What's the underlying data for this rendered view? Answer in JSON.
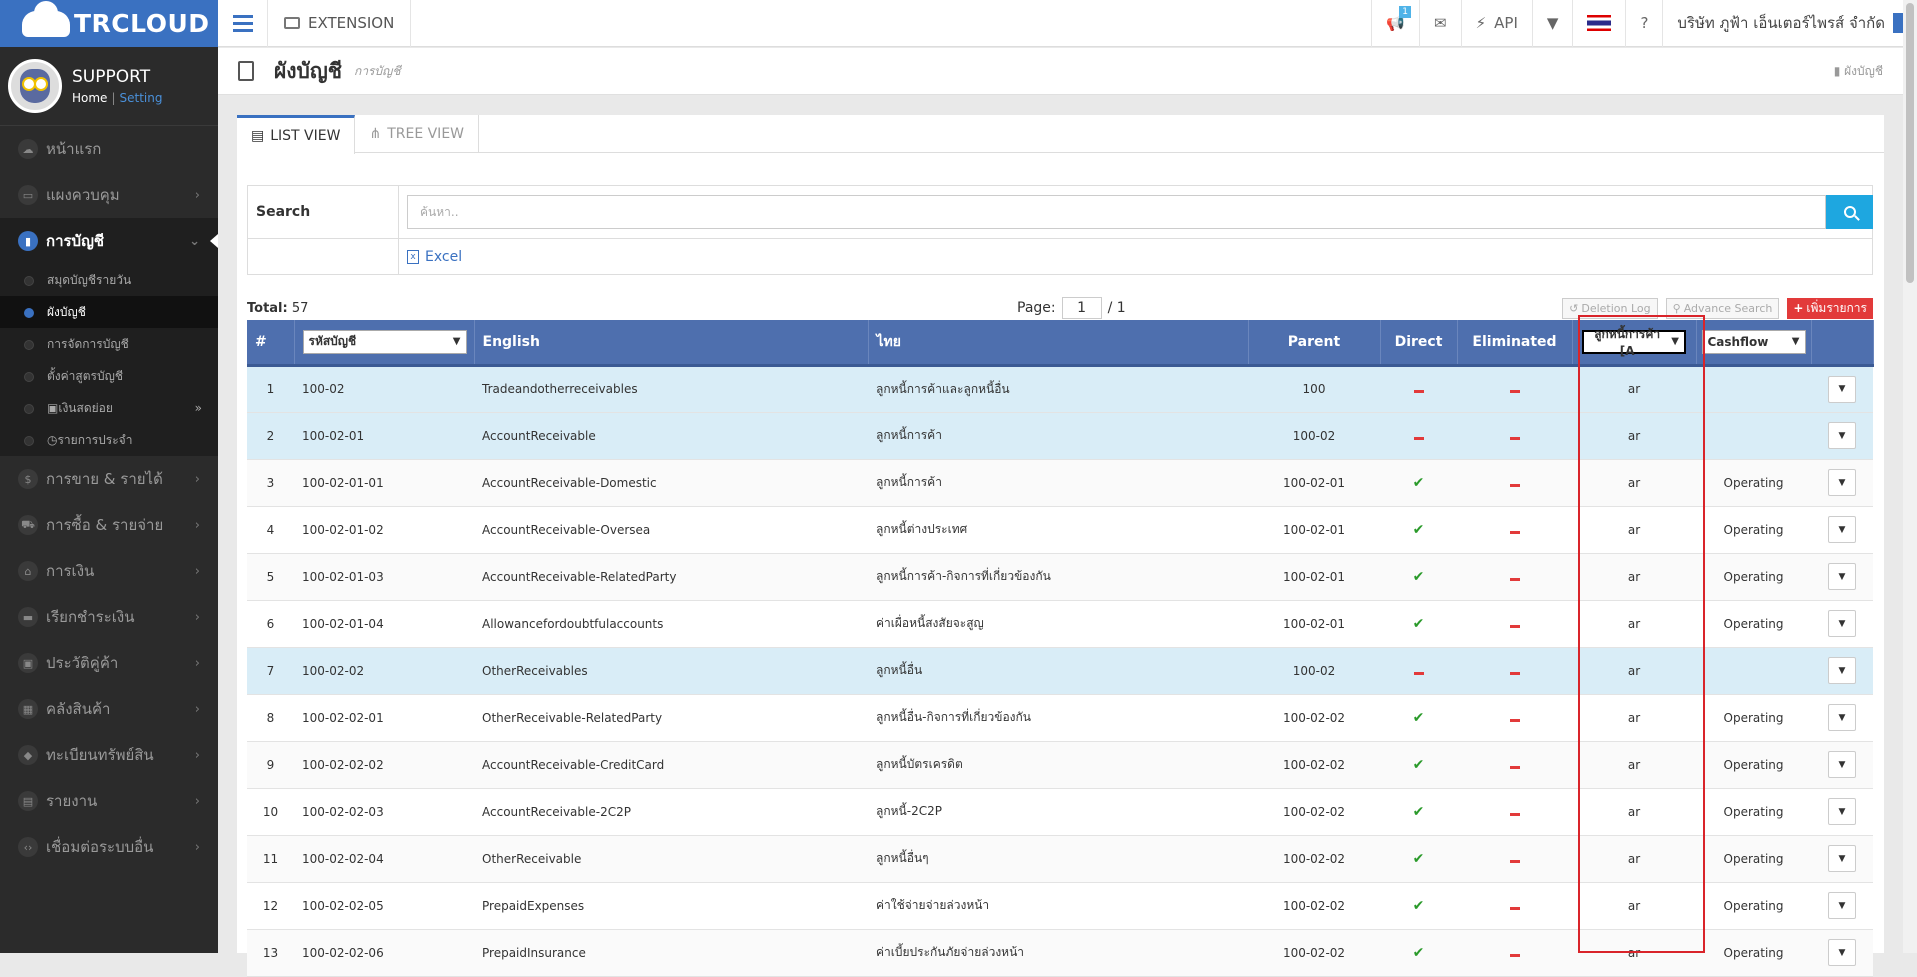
{
  "brand": {
    "logo": "TRCLOUD"
  },
  "profile": {
    "name": "SUPPORT",
    "home": "Home",
    "separator": "|",
    "setting": "Setting"
  },
  "sidebar": {
    "items": [
      {
        "label": "หน้าแรก",
        "icon": "cloud-icon"
      },
      {
        "label": "แผงควบคุม",
        "icon": "monitor-icon"
      },
      {
        "label": "การบัญชี",
        "icon": "book-icon",
        "active": true
      },
      {
        "label": "การขาย & รายได้",
        "icon": "dollar-icon"
      },
      {
        "label": "การซื้อ & รายจ่าย",
        "icon": "cart-icon"
      },
      {
        "label": "การเงิน",
        "icon": "bank-icon"
      },
      {
        "label": "เรียกชำระเงิน",
        "icon": "card-icon"
      },
      {
        "label": "ประวัติคู่ค้า",
        "icon": "contact-icon"
      },
      {
        "label": "คลังสินค้า",
        "icon": "boxes-icon"
      },
      {
        "label": "ทะเบียนทรัพย์สิน",
        "icon": "diamond-icon"
      },
      {
        "label": "รายงาน",
        "icon": "report-icon"
      },
      {
        "label": "เชื่อมต่อระบบอื่น",
        "icon": "code-icon"
      }
    ],
    "sub_items": [
      {
        "label": "สมุดบัญชีรายวัน"
      },
      {
        "label": "ผังบัญชี",
        "active": true
      },
      {
        "label": "การจัดการบัญชี"
      },
      {
        "label": "ตั้งค่าสูตรบัญชี"
      },
      {
        "label": "เงินสดย่อย",
        "icon": "id-card-icon"
      },
      {
        "label": "รายการประจำ",
        "icon": "clock-icon"
      }
    ]
  },
  "topbar": {
    "extension": "EXTENSION",
    "badge_count": "1",
    "api": "API",
    "company": "บริษัท ภูฟ้า เอ็นเตอร์ไพรส์ จำกัด"
  },
  "page": {
    "title": "ผังบัญชี",
    "subtitle": "การบัญชี",
    "breadcrumb": "ผังบัญชี"
  },
  "tabs": {
    "list": "LIST VIEW",
    "tree": "TREE VIEW"
  },
  "search": {
    "label": "Search",
    "placeholder": "ค้นหา..",
    "excel": "Excel"
  },
  "toolbar": {
    "total_label": "Total:",
    "total": "57",
    "page_label": "Page:",
    "page": "1",
    "page_of": "/ 1",
    "deletion_log": "Deletion Log",
    "advance_search": "Advance Search",
    "add": "เพิ่มรายการ"
  },
  "table": {
    "headers": {
      "num": "#",
      "code_select": "รหัสบัญชี",
      "english": "English",
      "thai": "ไทย",
      "parent": "Parent",
      "direct": "Direct",
      "eliminated": "Eliminated",
      "ar_select": "ลูกหนี้การค้า [A",
      "cashflow_select": "Cashflow"
    },
    "rows": [
      {
        "num": "1",
        "code": "100-02",
        "english": "Tradeandotherreceivables",
        "thai": "ลูกหนี้การค้าและลูกหนี้อื่น",
        "parent": "100",
        "direct": false,
        "eliminated": false,
        "ar": "ar",
        "cashflow": "",
        "highlight": true
      },
      {
        "num": "2",
        "code": "100-02-01",
        "english": "AccountReceivable",
        "thai": "ลูกหนี้การค้า",
        "parent": "100-02",
        "direct": false,
        "eliminated": false,
        "ar": "ar",
        "cashflow": "",
        "highlight": true
      },
      {
        "num": "3",
        "code": "100-02-01-01",
        "english": "AccountReceivable-Domestic",
        "thai": "ลูกหนี้การค้า",
        "parent": "100-02-01",
        "direct": true,
        "eliminated": false,
        "ar": "ar",
        "cashflow": "Operating"
      },
      {
        "num": "4",
        "code": "100-02-01-02",
        "english": "AccountReceivable-Oversea",
        "thai": "ลูกหนี้ต่างประเทศ",
        "parent": "100-02-01",
        "direct": true,
        "eliminated": false,
        "ar": "ar",
        "cashflow": "Operating"
      },
      {
        "num": "5",
        "code": "100-02-01-03",
        "english": "AccountReceivable-RelatedParty",
        "thai": "ลูกหนี้การค้า-กิจการที่เกี่ยวข้องกัน",
        "parent": "100-02-01",
        "direct": true,
        "eliminated": false,
        "ar": "ar",
        "cashflow": "Operating"
      },
      {
        "num": "6",
        "code": "100-02-01-04",
        "english": "Allowancefordoubtfulaccounts",
        "thai": "ค่าเผื่อหนี้สงสัยจะสูญ",
        "parent": "100-02-01",
        "direct": true,
        "eliminated": false,
        "ar": "ar",
        "cashflow": "Operating"
      },
      {
        "num": "7",
        "code": "100-02-02",
        "english": "OtherReceivables",
        "thai": "ลูกหนี้อื่น",
        "parent": "100-02",
        "direct": false,
        "eliminated": false,
        "ar": "ar",
        "cashflow": "",
        "highlight": true
      },
      {
        "num": "8",
        "code": "100-02-02-01",
        "english": "OtherReceivable-RelatedParty",
        "thai": "ลูกหนี้อื่น-กิจการที่เกี่ยวข้องกัน",
        "parent": "100-02-02",
        "direct": true,
        "eliminated": false,
        "ar": "ar",
        "cashflow": "Operating"
      },
      {
        "num": "9",
        "code": "100-02-02-02",
        "english": "AccountReceivable-CreditCard",
        "thai": "ลูกหนี้บัตรเครดิต",
        "parent": "100-02-02",
        "direct": true,
        "eliminated": false,
        "ar": "ar",
        "cashflow": "Operating"
      },
      {
        "num": "10",
        "code": "100-02-02-03",
        "english": "AccountReceivable-2C2P",
        "thai": "ลูกหนี้-2C2P",
        "parent": "100-02-02",
        "direct": true,
        "eliminated": false,
        "ar": "ar",
        "cashflow": "Operating"
      },
      {
        "num": "11",
        "code": "100-02-02-04",
        "english": "OtherReceivable",
        "thai": "ลูกหนี้อื่นๆ",
        "parent": "100-02-02",
        "direct": true,
        "eliminated": false,
        "ar": "ar",
        "cashflow": "Operating"
      },
      {
        "num": "12",
        "code": "100-02-02-05",
        "english": "PrepaidExpenses",
        "thai": "ค่าใช้จ่ายจ่ายล่วงหน้า",
        "parent": "100-02-02",
        "direct": true,
        "eliminated": false,
        "ar": "ar",
        "cashflow": "Operating"
      },
      {
        "num": "13",
        "code": "100-02-02-06",
        "english": "PrepaidInsurance",
        "thai": "ค่าเบี้ยประกันภัยจ่ายล่วงหน้า",
        "parent": "100-02-02",
        "direct": true,
        "eliminated": false,
        "ar": "ar",
        "cashflow": "Operating"
      }
    ]
  },
  "colors": {
    "brand": "#3a71c1",
    "header": "#4e6fae",
    "highlight": "#d9edf7",
    "accent_red": "#d9242a"
  }
}
